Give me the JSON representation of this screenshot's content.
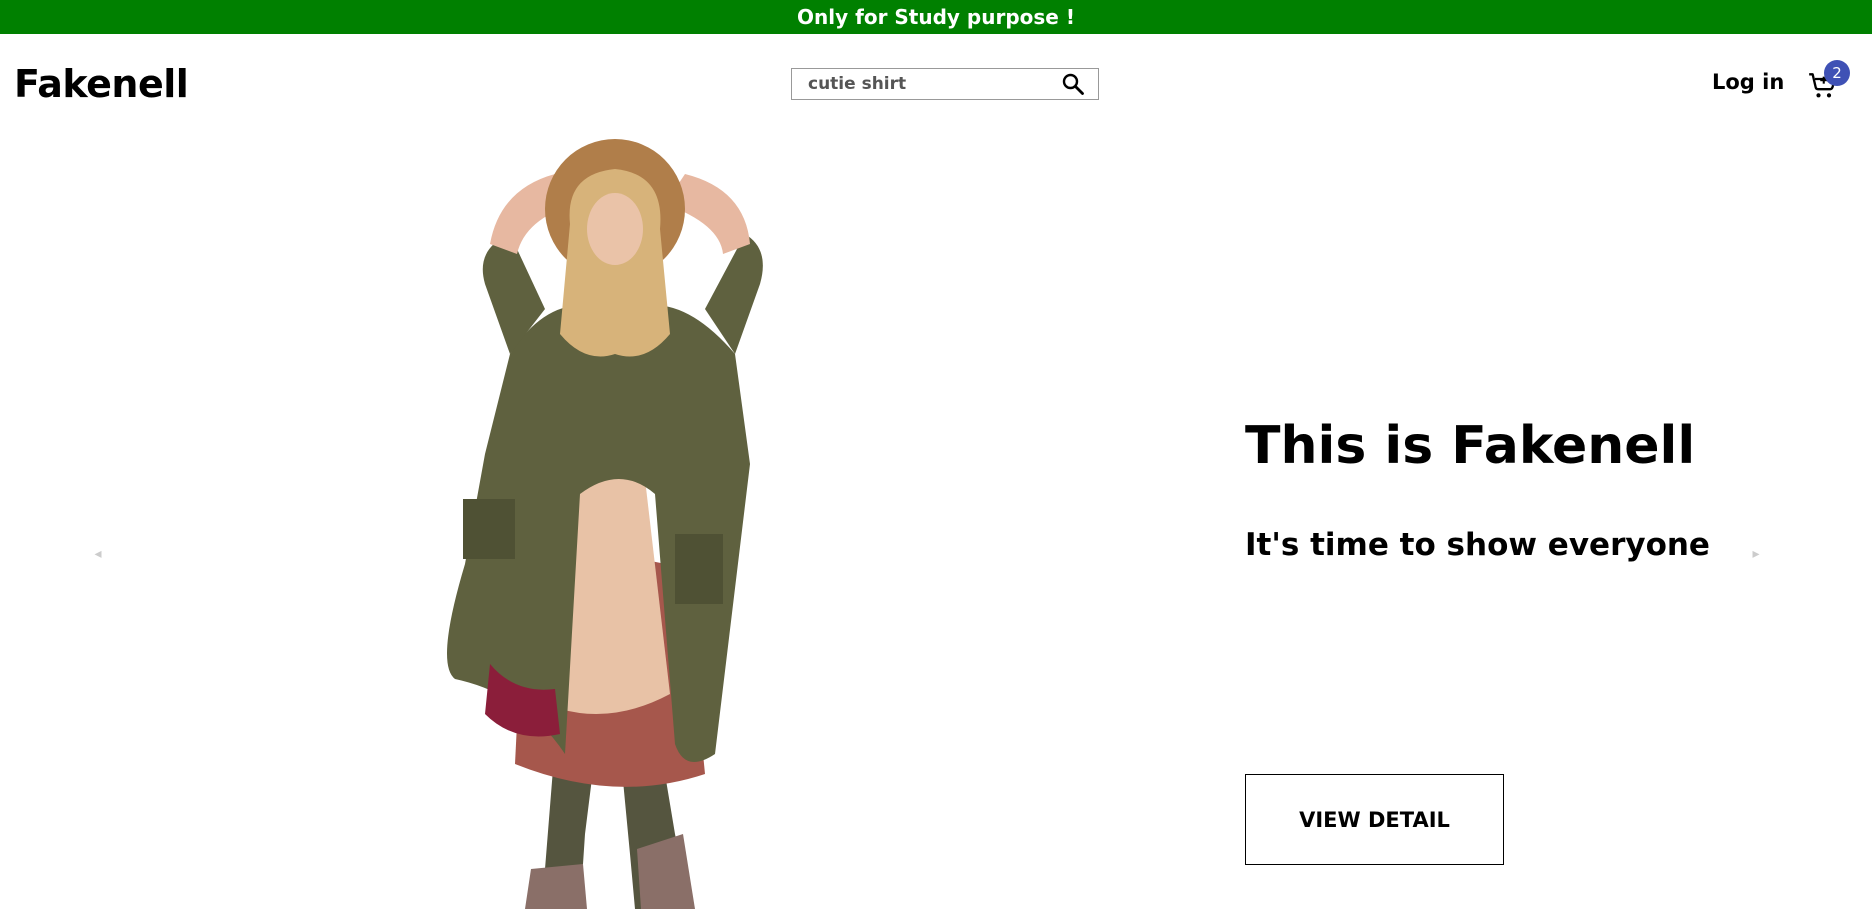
{
  "banner": {
    "text": "Only for Study purpose !"
  },
  "header": {
    "logo": "Fakenell",
    "search": {
      "value": "cutie shirt",
      "placeholder": ""
    },
    "login_label": "Log in",
    "cart": {
      "count": "2",
      "icon": "cart-icon"
    },
    "search_icon": "search-icon"
  },
  "hero": {
    "title": "This is Fakenell",
    "subtitle": "It's time to show everyone",
    "button_label": "VIEW DETAIL",
    "image_alt": "model-image",
    "prev_arrow": "◂",
    "next_arrow": "▸"
  },
  "colors": {
    "banner_bg": "#008000",
    "badge_bg": "#3f51b5",
    "text": "#000000"
  }
}
